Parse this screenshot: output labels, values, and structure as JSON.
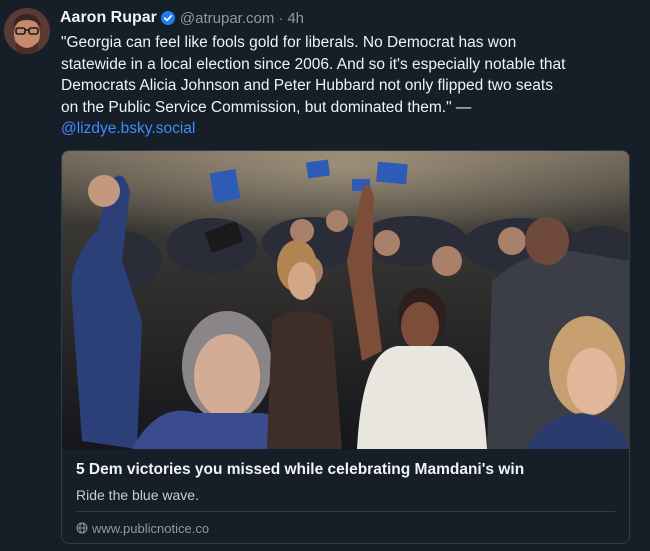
{
  "author": {
    "display_name": "Aaron Rupar",
    "handle": "@atrupar.com",
    "separator": "·",
    "timestamp": "4h",
    "avatar_icon": "user-avatar"
  },
  "post": {
    "lines": [
      "\"Georgia can feel like fools gold for liberals. No Democrat has won",
      "statewide in a local election since 2006. And so it's especially notable that",
      "Democrats Alicia Johnson and Peter Hubbard not only flipped two seats",
      "on the Public Service Commission, but dominated them.\" —"
    ],
    "mention": "@lizdye.bsky.social"
  },
  "link_card": {
    "title": "5 Dem victories you missed while celebrating Mamdani's win",
    "description": "Ride the blue wave.",
    "domain": "www.publicnotice.co",
    "domain_icon": "globe-icon"
  },
  "colors": {
    "background": "#161e27",
    "text": "#f1f3f5",
    "muted": "#8d99a6",
    "link": "#3f8dff",
    "verified": "#1d7cf2",
    "border": "#2f3b47"
  }
}
